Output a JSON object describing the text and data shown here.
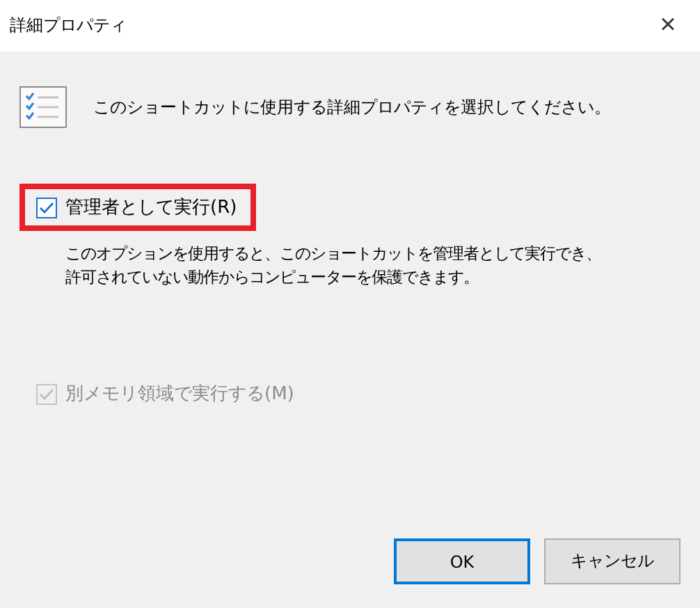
{
  "window": {
    "title": "詳細プロパティ",
    "close": "×"
  },
  "heading": "このショートカットに使用する詳細プロパティを選択してください。",
  "options": [
    {
      "label": "管理者として実行(R)",
      "checked": true,
      "disabled": false,
      "highlighted": true,
      "description": "このオプションを使用すると、このショートカットを管理者として実行でき、許可されていない動作からコンピューターを保護できます。"
    },
    {
      "label": "別メモリ領域で実行する(M)",
      "checked": true,
      "disabled": true,
      "highlighted": false
    }
  ],
  "buttons": [
    {
      "label": "OK",
      "default": true
    },
    {
      "label": "キャンセル",
      "default": false
    }
  ]
}
